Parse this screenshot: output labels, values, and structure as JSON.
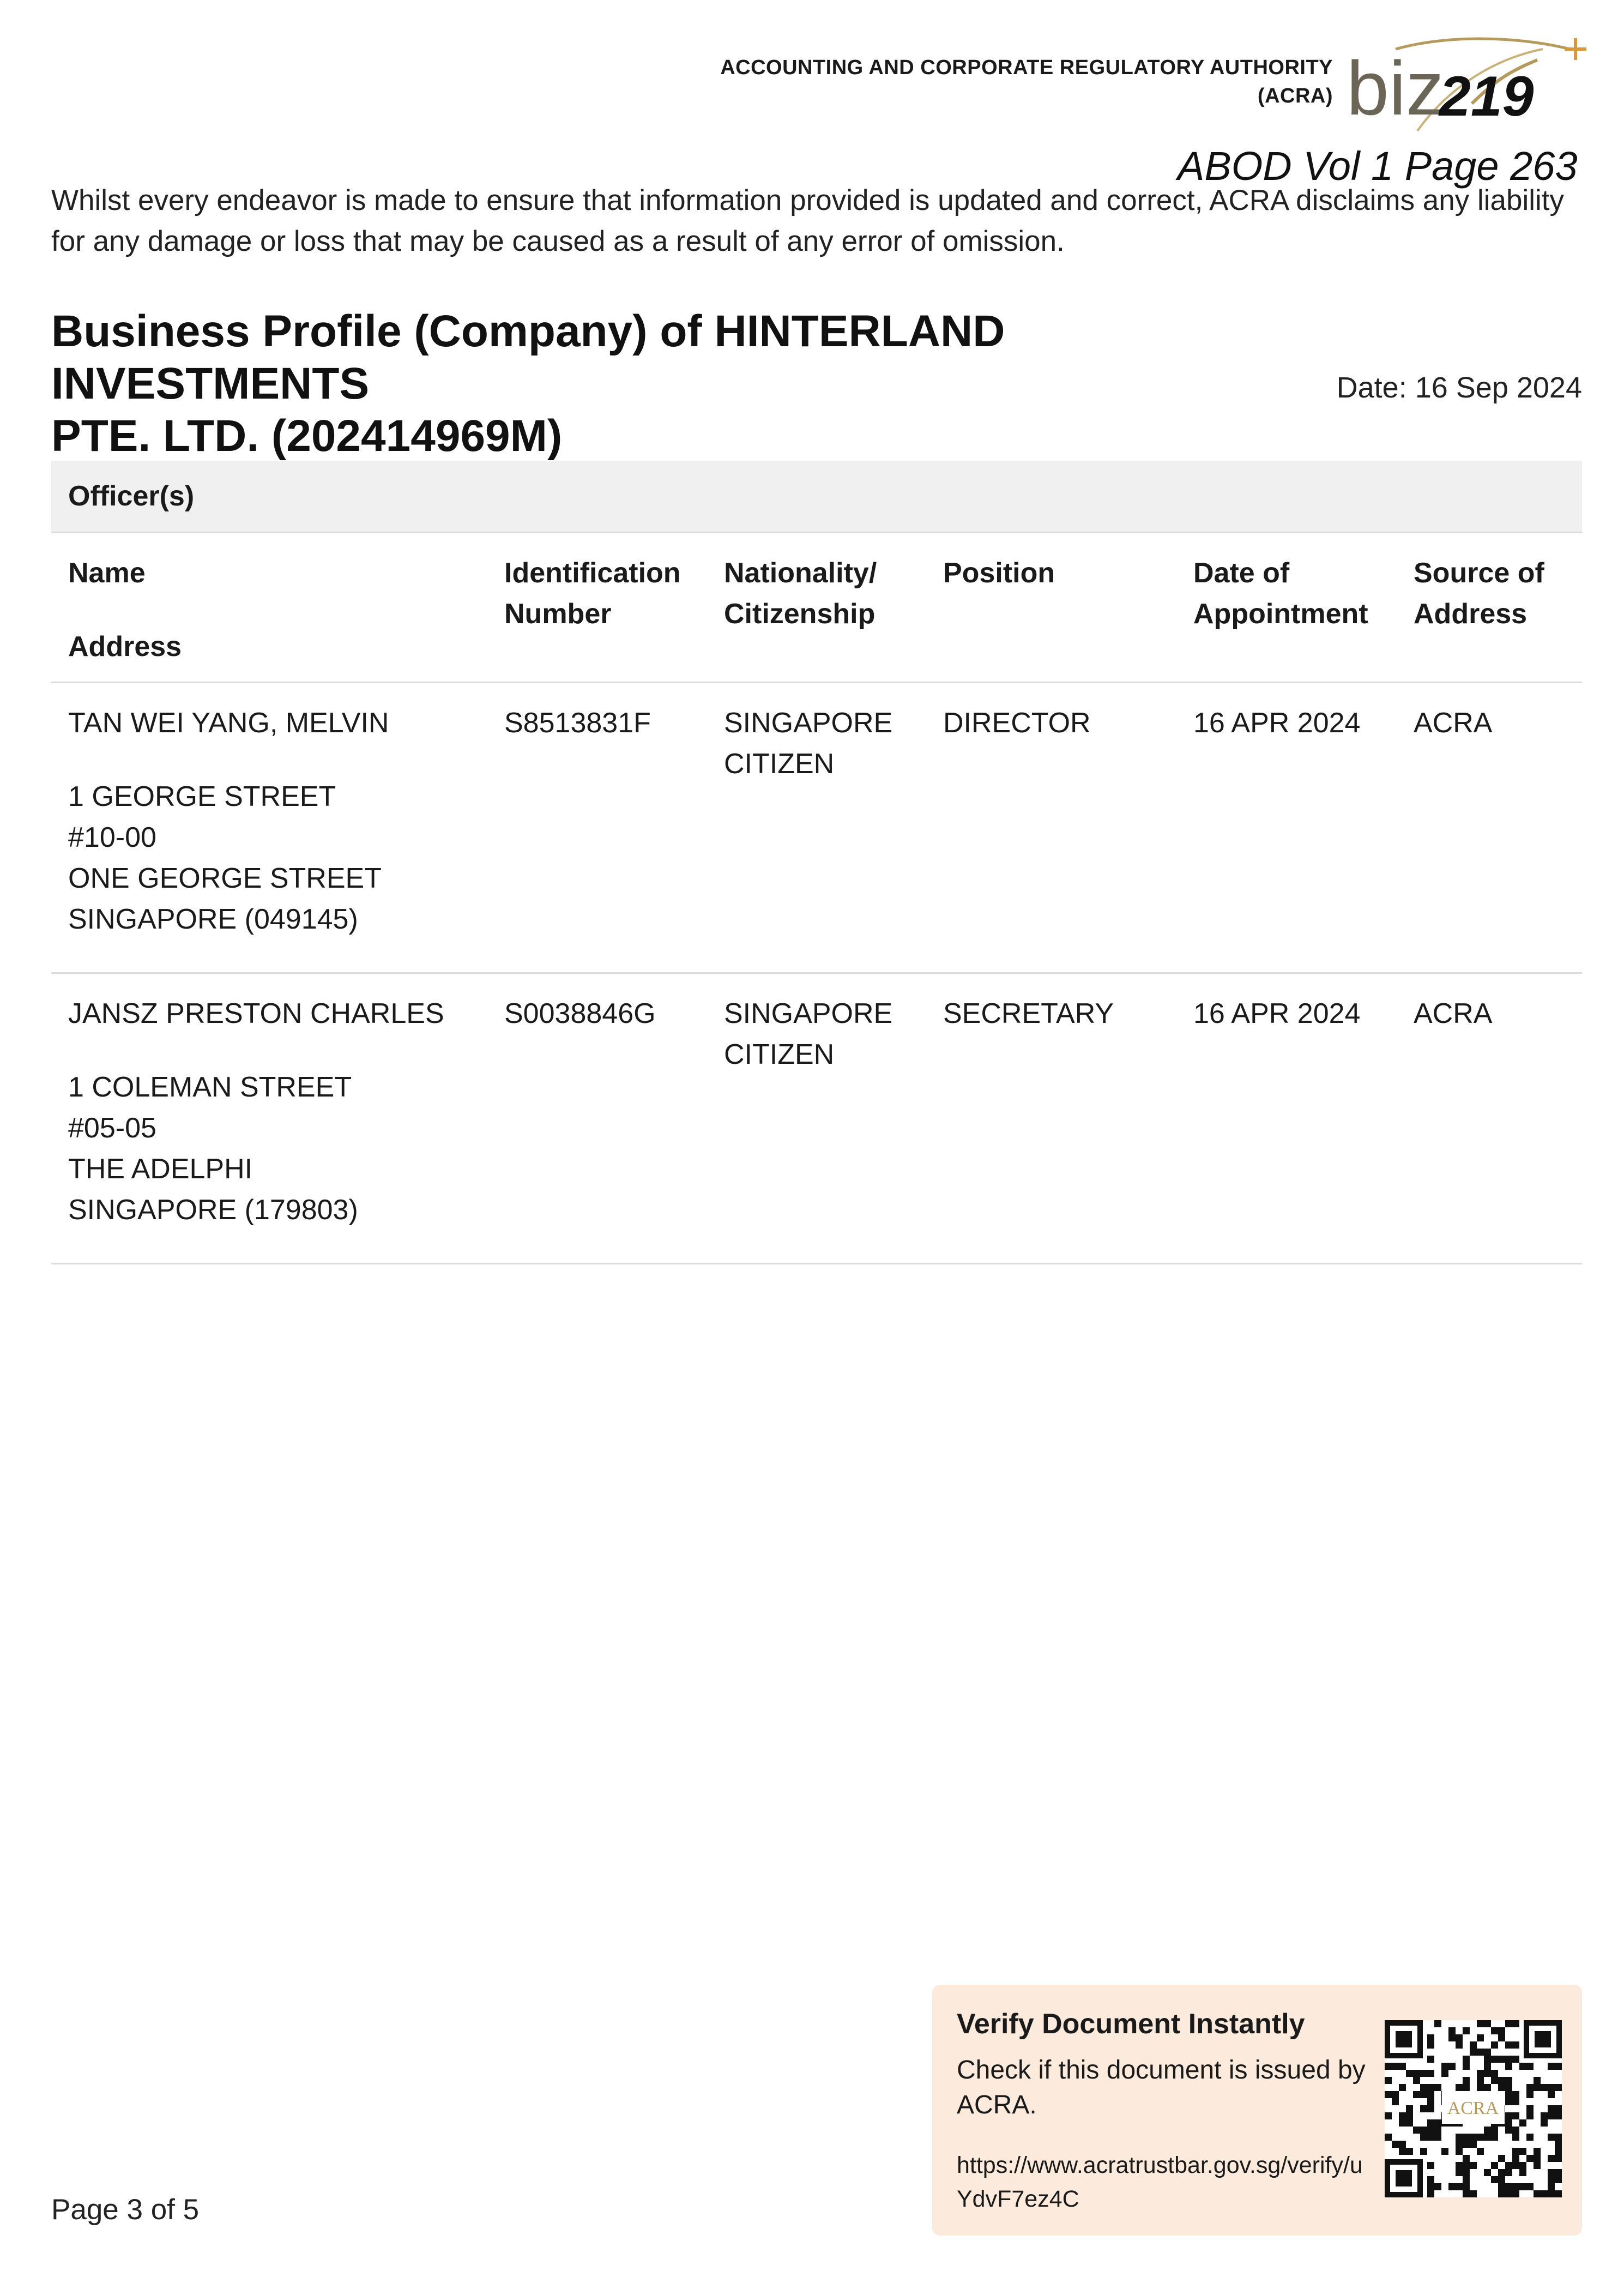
{
  "header": {
    "authority_line1": "ACCOUNTING AND CORPORATE REGULATORY AUTHORITY",
    "authority_line2": "(ACRA)",
    "logo_text": "biz",
    "stamp_number": "219",
    "stamp_ref": "ABOD Vol 1 Page 263"
  },
  "disclaimer": "Whilst every endeavor is made to ensure that information provided is updated and correct, ACRA disclaims any liability for any damage or loss that may be caused as a result of any error of omission.",
  "title": {
    "line1": "Business Profile (Company) of HINTERLAND INVESTMENTS",
    "line2": "PTE. LTD. (202414969M)",
    "date": "Date: 16 Sep 2024"
  },
  "officers": {
    "section_title": "Officer(s)",
    "headers": {
      "name": "Name",
      "address": "Address",
      "id_line1": "Identification",
      "id_line2": "Number",
      "nat_line1": "Nationality/",
      "nat_line2": "Citizenship",
      "position": "Position",
      "date_line1": "Date of",
      "date_line2": "Appointment",
      "source_line1": "Source of",
      "source_line2": "Address"
    },
    "rows": [
      {
        "name": "TAN WEI YANG, MELVIN",
        "address": [
          "1 GEORGE STREET",
          "#10-00",
          "ONE GEORGE STREET",
          "SINGAPORE (049145)"
        ],
        "id": "S8513831F",
        "nationality_line1": "SINGAPORE",
        "nationality_line2": "CITIZEN",
        "position": "DIRECTOR",
        "date": "16 APR 2024",
        "source": "ACRA"
      },
      {
        "name": "JANSZ PRESTON CHARLES",
        "address": [
          "1 COLEMAN STREET",
          "#05-05",
          "THE ADELPHI",
          "SINGAPORE (179803)"
        ],
        "id": "S0038846G",
        "nationality_line1": "SINGAPORE",
        "nationality_line2": "CITIZEN",
        "position": "SECRETARY",
        "date": "16 APR 2024",
        "source": "ACRA"
      }
    ]
  },
  "footer": {
    "page": "Page 3 of 5",
    "verify_title": "Verify Document Instantly",
    "verify_text": "Check if this document is issued by ACRA.",
    "verify_url": "https://www.acratrustbar.gov.sg/verify/uYdvF7ez4C",
    "qr_label": "ACRA"
  },
  "colors": {
    "logo_gold": "#b59a5e",
    "logo_gray": "#6b6558",
    "verify_bg": "#fcebdd",
    "section_bg": "#f0f0f0"
  }
}
